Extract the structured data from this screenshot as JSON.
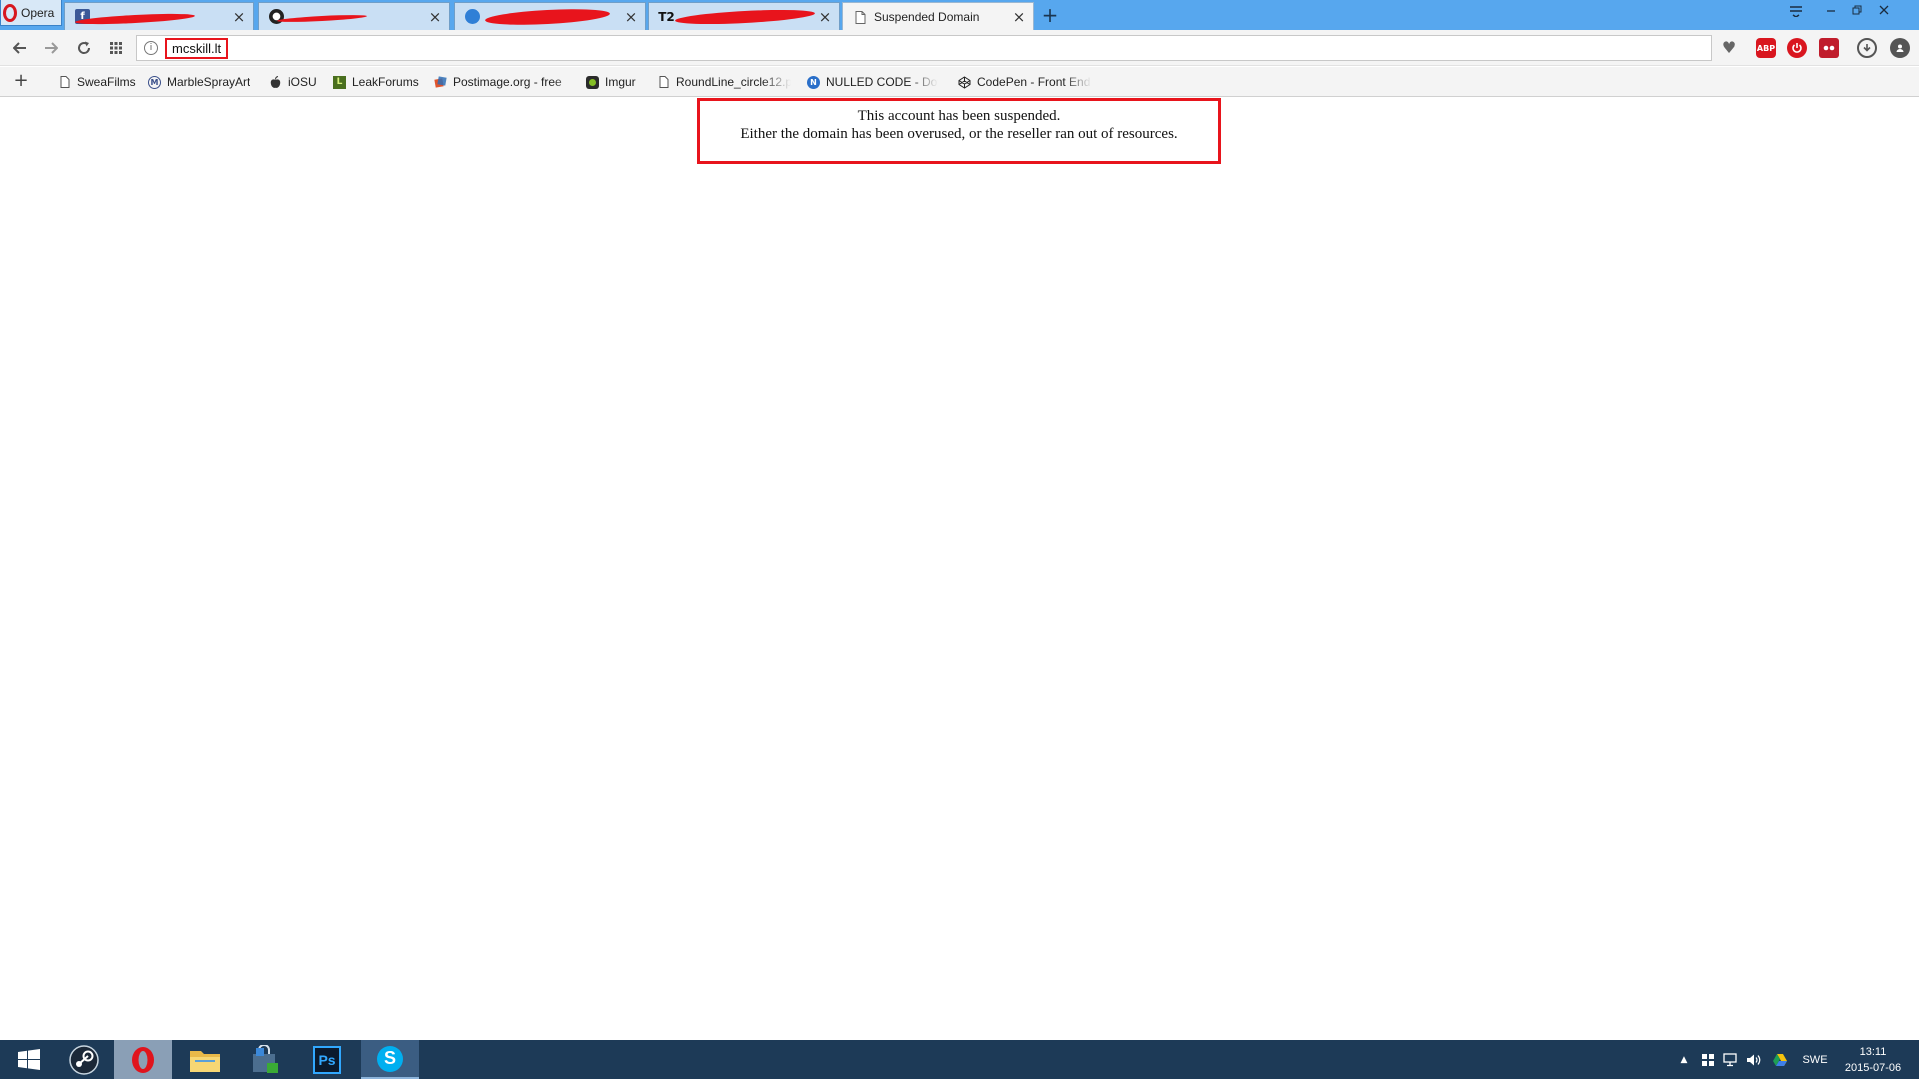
{
  "menu": {
    "label": "Opera"
  },
  "tabs": [
    {
      "title": "",
      "icon": "facebook-icon",
      "redacted": true
    },
    {
      "title": "",
      "icon": "github-icon",
      "redacted": true
    },
    {
      "title": "",
      "icon": "globe-icon",
      "redacted": true
    },
    {
      "title": "",
      "icon": "t2-icon",
      "icon_text": "T2",
      "redacted": true
    },
    {
      "title": "Suspended Domain",
      "icon": "page-icon",
      "active": true
    }
  ],
  "tab_close_glyph": "×",
  "new_tab_glyph": "+",
  "address": {
    "url": "mcskill.lt"
  },
  "extensions": [
    {
      "name": "adblock-plus-icon",
      "text": "ABP",
      "color": "#d9161f"
    },
    {
      "name": "power-icon",
      "text": "",
      "color": "#d9161f"
    },
    {
      "name": "extension-icon",
      "text": "",
      "color": "#c01d2c"
    },
    {
      "name": "download-icon",
      "text": "",
      "color": "#555555"
    },
    {
      "name": "account-icon",
      "text": "",
      "color": "#555555"
    }
  ],
  "bookmarks": [
    {
      "label": "SweaFilms",
      "icon": "page-icon"
    },
    {
      "label": "MarbleSprayArt",
      "icon": "m-circle-icon"
    },
    {
      "label": "iOSU",
      "icon": "apple-icon"
    },
    {
      "label": "LeakForums",
      "icon": "leakforums-icon"
    },
    {
      "label": "Postimage.org - free",
      "icon": "postimage-icon"
    },
    {
      "label": "Imgur",
      "icon": "imgur-icon"
    },
    {
      "label": "RoundLine_circle12.p",
      "icon": "page-icon"
    },
    {
      "label": "NULLED CODE - Dow",
      "icon": "nulled-icon"
    },
    {
      "label": "CodePen - Front End",
      "icon": "codepen-icon"
    }
  ],
  "page": {
    "line1": "This account has been suspended.",
    "line2": "Either the domain has been overused, or the reseller ran out of resources."
  },
  "taskbar": {
    "apps": [
      "start-icon",
      "steam-icon",
      "opera-icon",
      "file-explorer-icon",
      "store-icon",
      "photoshop-icon",
      "skype-icon"
    ],
    "photoshop_text": "Ps",
    "skype_text": "S",
    "language": "SWE",
    "time": "13:11",
    "date": "2015-07-06"
  },
  "colors": {
    "tabstrip": "#57a7ee",
    "highlight_red": "#e8141c",
    "taskbar": "#1d3a57"
  }
}
